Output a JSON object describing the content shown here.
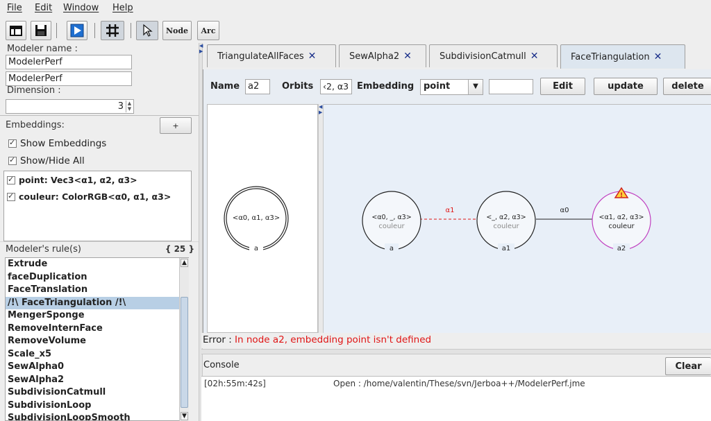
{
  "menu": [
    "File",
    "Edit",
    "Window",
    "Help"
  ],
  "toolbar": {
    "icons": [
      "new-window-icon",
      "save-icon",
      "run-icon",
      "grid-icon",
      "pointer-icon"
    ],
    "node_label": "Node",
    "arc_label": "Arc"
  },
  "left": {
    "modeler_name_label": "Modeler name :",
    "modeler_name_value": "ModelerPerf",
    "module_value": "ModelerPerf",
    "dimension_label": "Dimension :",
    "dimension_value": "3",
    "embeddings_label": "Embeddings:",
    "add_label": "+",
    "show_embeddings": "Show Embeddings",
    "show_hide_all": "Show/Hide All",
    "embeddings": [
      "point: Vec3<α1, α2, α3>",
      "couleur: ColorRGB<α0, α1, α3>"
    ],
    "rules_label": "Modeler's rule(s)",
    "rules_count": "{ 25 }",
    "rules": [
      "Extrude",
      "faceDuplication",
      "FaceTranslation",
      "/!\\ FaceTriangulation /!\\",
      "MengerSponge",
      "RemoveInternFace",
      "RemoveVolume",
      "Scale_x5",
      "SewAlpha0",
      "SewAlpha2",
      "SubdivisionCatmull",
      "SubdivisionLoop",
      "SubdivisionLoopSmooth"
    ],
    "selected_rule_index": 3
  },
  "tabs": [
    {
      "label": "TriangulateAllFaces",
      "close": "✕"
    },
    {
      "label": "SewAlpha2",
      "close": "✕"
    },
    {
      "label": "SubdivisionCatmull",
      "close": "✕"
    },
    {
      "label": "FaceTriangulation",
      "close": "✕"
    }
  ],
  "active_tab_index": 3,
  "editor": {
    "name_label": "Name",
    "name_value": "a2",
    "orbits_label": "Orbits",
    "orbits_value": "‹2, α3",
    "embedding_label": "Embedding",
    "embedding_value": "point",
    "embedding_input": "",
    "edit_label": "Edit",
    "update_label": "update",
    "delete_label": "delete"
  },
  "graph": {
    "left_node": {
      "orbit": "<α0, α1, α3>",
      "name": "a"
    },
    "nodes": [
      {
        "orbit": "<α0, _, α3>",
        "embedding": "couleur",
        "name": "a"
      },
      {
        "orbit": "<_, α2, α3>",
        "embedding": "couleur",
        "name": "a1"
      },
      {
        "orbit": "<α1, α2, α3>",
        "embedding": "couleur",
        "name": "a2"
      }
    ],
    "arcs": [
      {
        "label": "α1",
        "style": "dashed",
        "color": "#e01414"
      },
      {
        "label": "α0",
        "style": "solid",
        "color": "#222222"
      }
    ],
    "warning_icon": "warning-icon",
    "error_node_color": "#c040c0"
  },
  "error": {
    "prefix": "Error : ",
    "message": "In node a2, embedding point isn't defined"
  },
  "console": {
    "title": "Console",
    "clear_label": "Clear",
    "time": "[02h:55m:42s]",
    "message": "Open : /home/valentin/These/svn/Jerboa++/ModelerPerf.jme"
  }
}
